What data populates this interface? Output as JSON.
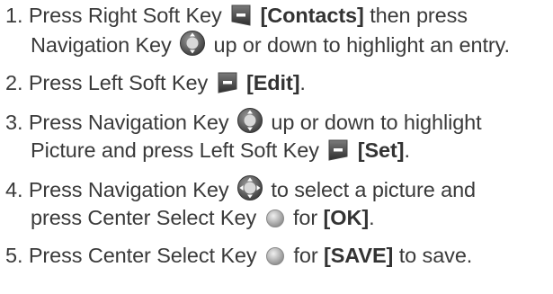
{
  "steps": [
    {
      "number": "1.",
      "text_a": "Press Right Soft Key",
      "bold_a": "[Contacts]",
      "text_b": "then press",
      "line2_a": "Navigation Key",
      "line2_b": "up or down to highlight an entry."
    },
    {
      "number": "2.",
      "text_a": "Press Left Soft Key",
      "bold_a": "[Edit]",
      "text_b": "."
    },
    {
      "number": "3.",
      "text_a": "Press Navigation Key",
      "text_b": "up or down to highlight",
      "line2_a": "Picture and press Left Soft Key",
      "bold_b": "[Set]",
      "line2_b": "."
    },
    {
      "number": "4.",
      "text_a": "Press Navigation Key",
      "text_b": "to select a picture and",
      "line2_a": "press Center Select Key",
      "line2_b": "for",
      "bold_b": "[OK]",
      "line2_c": "."
    },
    {
      "number": "5.",
      "text_a": "Press Center Select Key",
      "text_b": "for",
      "bold_a": "[SAVE]",
      "text_c": "to save."
    }
  ],
  "icons": {
    "right_softkey": "right-soft-key-icon",
    "left_softkey": "left-soft-key-icon",
    "navigation_updown": "navigation-key-up-down-icon",
    "navigation_4way": "navigation-key-4way-icon",
    "center_select": "center-select-key-icon"
  }
}
